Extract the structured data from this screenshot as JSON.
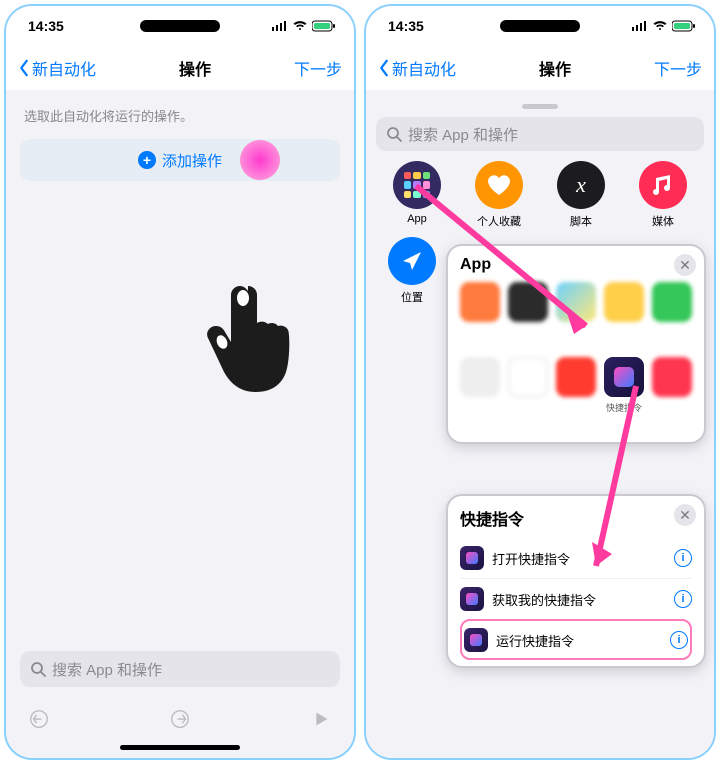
{
  "status": {
    "time": "14:35"
  },
  "nav": {
    "back": "新自动化",
    "title": "操作",
    "next": "下一步"
  },
  "left": {
    "subtitle": "选取此自动化将运行的操作。",
    "add_label": "添加操作",
    "search_placeholder": "搜索 App 和操作"
  },
  "right": {
    "search_placeholder": "搜索 App 和操作",
    "categories": [
      "App",
      "个人收藏",
      "脚本",
      "媒体",
      "位置"
    ],
    "popup_apps": {
      "title": "App",
      "shortcut_label": "快捷指令"
    },
    "popup_actions": {
      "title": "快捷指令",
      "items": [
        "打开快捷指令",
        "获取我的快捷指令",
        "运行快捷指令"
      ],
      "highlight_index": 2
    }
  }
}
